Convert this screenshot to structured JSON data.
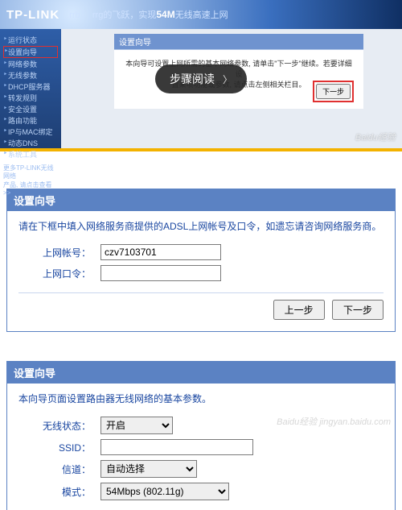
{
  "shot1": {
    "logo": "TP-LINK",
    "banner_mid": "的飞跃，实现",
    "banner_speed": "54M",
    "banner_tail": "无线高速上网",
    "sidebar": {
      "items": [
        "运行状态",
        "设置向导",
        "网络参数",
        "无线参数",
        "DHCP服务器",
        "转发规则",
        "安全设置",
        "路由功能",
        "IP与MAC绑定",
        "动态DNS",
        "系统工具"
      ],
      "foot1": "更多TP-LINK无线网络",
      "foot2": "产品, 请点击查看 >>"
    },
    "panel": {
      "title": "设置向导",
      "line1": "本向导可设置上网所需的基本网络参数, 请单击\"下一步\"继续。若要详细设",
      "line2": "置某项功能或参数, 请点击左侧相关栏目。",
      "next": "下一步"
    },
    "overlay": "步骤阅读",
    "watermark": "Baidu经验"
  },
  "panel2": {
    "title": "设置向导",
    "hint": "请在下框中填入网络服务商提供的ADSL上网帐号及口令，如遗忘请咨询网络服务商。",
    "acct_label": "上网帐号：",
    "acct_value": "czv7103701",
    "pwd_label": "上网口令：",
    "pwd_value": "",
    "prev": "上一步",
    "next": "下一步"
  },
  "panel3": {
    "title": "设置向导",
    "hint": "本向导页面设置路由器无线网络的基本参数。",
    "state_label": "无线状态：",
    "state_value": "开启",
    "ssid_label": "SSID：",
    "ssid_value": "",
    "chan_label": "信道：",
    "chan_value": "自动选择",
    "mode_label": "模式：",
    "mode_value": "54Mbps (802.11g)"
  },
  "watermark2": "Baidu经验  jingyan.baidu.com"
}
